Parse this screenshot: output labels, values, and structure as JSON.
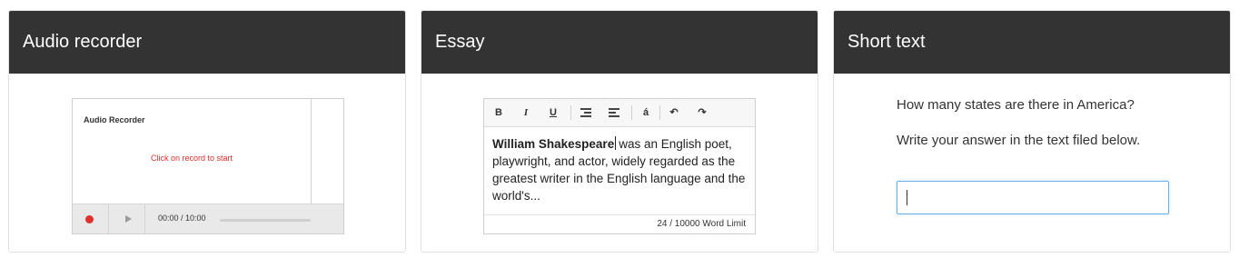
{
  "cards": [
    {
      "title": "Audio recorder"
    },
    {
      "title": "Essay"
    },
    {
      "title": "Short text"
    }
  ],
  "audio_recorder": {
    "widget_title": "Audio Recorder",
    "message": "Click on record to start",
    "time": "00:00 / 10:00",
    "record_color": "#e0312e"
  },
  "essay": {
    "toolbar": {
      "bold": "B",
      "italic": "I",
      "underline": "U",
      "special_char": "á",
      "undo": "↶",
      "redo": "↷"
    },
    "bold_text": "William Shakespeare",
    "text": "was an English poet, playwright, and actor, widely regarded as the greatest writer in the English language and the world's...",
    "word_count": "24 / 10000 Word Limit"
  },
  "short_text": {
    "question": "How many states are there in America?",
    "instruction": "Write your answer in the text filed below.",
    "answer_value": "",
    "focus_color": "#66afe9"
  },
  "colors": {
    "header_bg": "#333333",
    "header_text": "#ffffff"
  }
}
